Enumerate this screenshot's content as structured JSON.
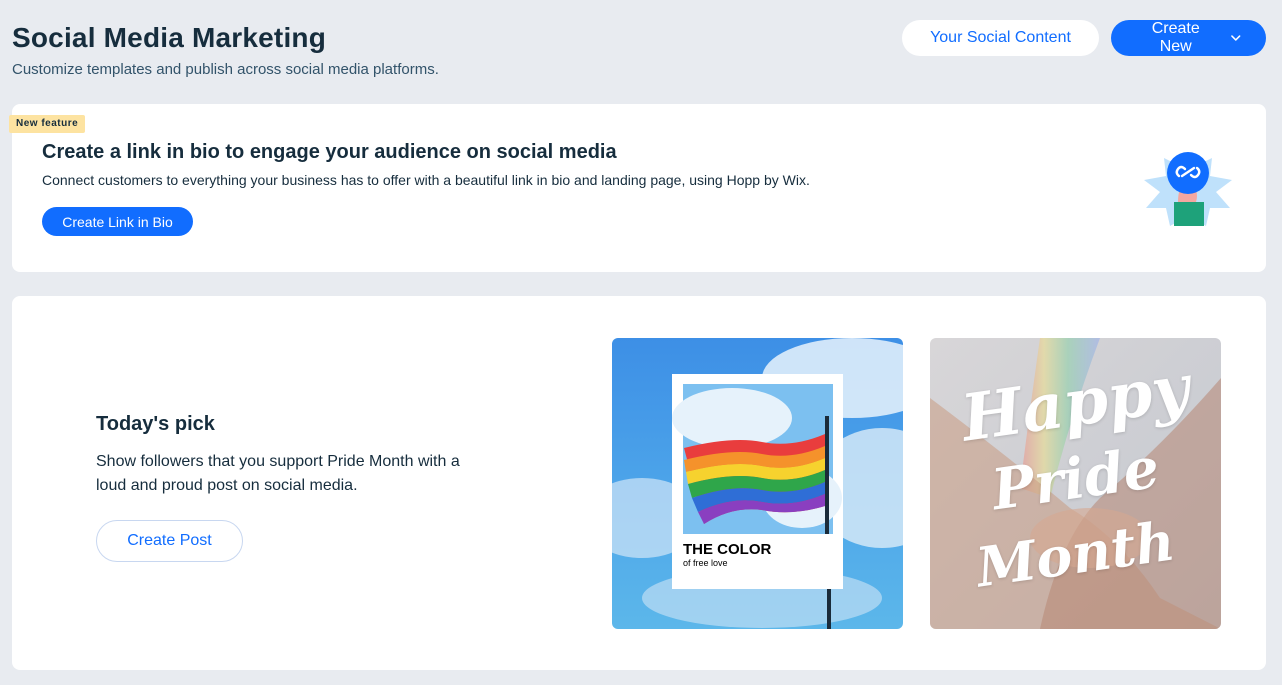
{
  "header": {
    "title": "Social Media Marketing",
    "subtitle": "Customize templates and publish across social media platforms.",
    "your_content_label": "Your Social Content",
    "create_new_label": "Create New"
  },
  "bio_card": {
    "badge": "New feature",
    "title": "Create a link in bio to engage your audience on social media",
    "description": "Connect customers to everything your business has to offer with a beautiful link in bio and landing page, using Hopp by Wix.",
    "button_label": "Create Link in Bio"
  },
  "pick_card": {
    "title": "Today's pick",
    "description": "Show followers that you support Pride Month with a loud and proud post on social media.",
    "button_label": "Create Post",
    "template_a": {
      "headline": "THE COLOR",
      "subline": "of free love"
    },
    "template_b": {
      "line1": "Happy",
      "line2": "Pride",
      "line3": "Month"
    }
  },
  "colors": {
    "accent": "#116dff",
    "background": "#e8ebf0",
    "badge": "#fde3a1",
    "text": "#162d3d"
  }
}
